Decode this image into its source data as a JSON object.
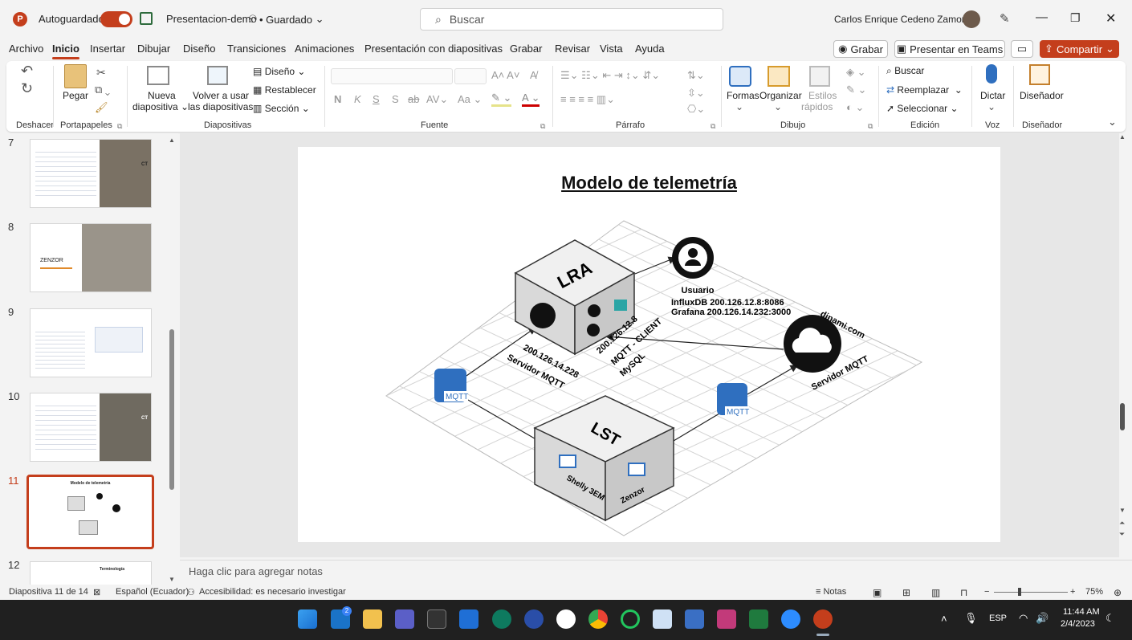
{
  "titlebar": {
    "app_icon": "powerpoint-icon",
    "autosave_label": "Autoguardado",
    "filename": "Presentacion-demo",
    "save_state": "• Guardado",
    "search_placeholder": "Buscar",
    "user_name": "Carlos Enrique Cedeno Zamora"
  },
  "menu": {
    "items": [
      "Archivo",
      "Inicio",
      "Insertar",
      "Dibujar",
      "Diseño",
      "Transiciones",
      "Animaciones",
      "Presentación con diapositivas",
      "Grabar",
      "Revisar",
      "Vista",
      "Ayuda"
    ],
    "active": "Inicio"
  },
  "header_buttons": {
    "record": "Grabar",
    "present_teams": "Presentar en Teams",
    "share": "Compartir"
  },
  "ribbon": {
    "undo_group": "Deshacer",
    "clipboard": {
      "paste": "Pegar",
      "group": "Portapapeles"
    },
    "slides": {
      "new_slide_1": "Nueva",
      "new_slide_2": "diapositiva",
      "reuse_1": "Volver a usar",
      "reuse_2": "las diapositivas",
      "layout": "Diseño",
      "reset": "Restablecer",
      "section": "Sección",
      "group": "Diapositivas"
    },
    "font": {
      "group": "Fuente",
      "bold": "N",
      "italic": "K",
      "underline": "S",
      "shadow": "S",
      "strike": "ab",
      "spacing": "AV",
      "case": "Aa",
      "color": "A"
    },
    "paragraph": {
      "group": "Párrafo"
    },
    "drawing": {
      "shapes": "Formas",
      "arrange": "Organizar",
      "styles_1": "Estilos",
      "styles_2": "rápidos",
      "group": "Dibujo"
    },
    "editing": {
      "find": "Buscar",
      "replace": "Reemplazar",
      "select": "Seleccionar",
      "group": "Edición"
    },
    "voice": {
      "dictate": "Dictar",
      "group": "Voz"
    },
    "designer": {
      "label": "Diseñador",
      "group": "Diseñador"
    }
  },
  "thumbnails": [
    {
      "num": "7",
      "label": "CT"
    },
    {
      "num": "8",
      "label": "ZENZOR"
    },
    {
      "num": "9",
      "label": ""
    },
    {
      "num": "10",
      "label": "CT"
    },
    {
      "num": "11",
      "label": "Modelo de telemetría"
    },
    {
      "num": "12",
      "label": "Terminología"
    }
  ],
  "slide": {
    "title": "Modelo de telemetría",
    "lra": "LRA",
    "lst": "LST",
    "user_label": "Usuario",
    "influx": "InfluxDB 200.126.12.8:8086",
    "grafana": "Grafana 200.126.14.232:3000",
    "dinami": "dinami.com",
    "servidor_mqtt_cloud": "Servidor MQTT",
    "lra_ip": "200.126.14.228",
    "lra_servidor": "Servidor MQTT",
    "client_ip": "200.126.12.8",
    "client_label": "MQTT - CLIENT",
    "mysql": "MySQL",
    "mqtt_badge": "MQTT",
    "shelly": "Shelly 3EM",
    "zenzor": "Zenzor"
  },
  "notes_placeholder": "Haga clic para agregar notas",
  "status": {
    "slide_info": "Diapositiva 11 de 14",
    "language": "Español (Ecuador)",
    "accessibility": "Accesibilidad: es necesario investigar",
    "notes": "Notas",
    "zoom": "75%"
  },
  "taskbar": {
    "lang": "ESP",
    "time": "11:44 AM",
    "date": "2/4/2023",
    "badge": "2"
  },
  "colors": {
    "accent": "#c43e1c",
    "mqtt_blue": "#2f6fbf",
    "taskbar": "#202020"
  }
}
